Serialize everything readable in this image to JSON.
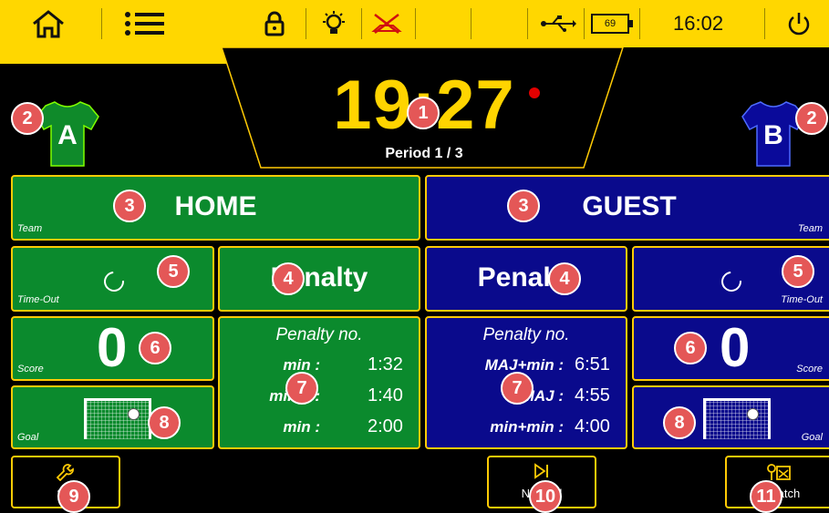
{
  "topbar": {
    "time": "16:02",
    "battery_level": "69",
    "icons": [
      "home-icon",
      "menu-icon",
      "lock-icon",
      "bulb-icon",
      "horn-muted-icon",
      "usb-icon",
      "battery-icon",
      "power-icon"
    ]
  },
  "clock": {
    "value": "19:27",
    "period": "Period 1 / 3"
  },
  "teams": {
    "home": {
      "jersey_letter": "A",
      "name": "HOME",
      "name_label": "Team",
      "timeout_label": "Time-Out",
      "penalty_title": "Penalty",
      "score": "0",
      "score_label": "Score",
      "goal_label": "Goal",
      "penalty_no": "Penalty no.",
      "penalties": [
        {
          "label": "min :",
          "value": "1:32"
        },
        {
          "label": "min T :",
          "value": "1:40"
        },
        {
          "label": "min :",
          "value": "2:00"
        }
      ]
    },
    "guest": {
      "jersey_letter": "B",
      "name": "GUEST",
      "name_label": "Team",
      "timeout_label": "Time-Out",
      "penalty_title": "Penalty",
      "score": "0",
      "score_label": "Score",
      "goal_label": "Goal",
      "penalty_no": "Penalty no.",
      "penalties": [
        {
          "label": "MAJ+min :",
          "value": "6:51"
        },
        {
          "label": "MAJ :",
          "value": "4:55"
        },
        {
          "label": "min+min :",
          "value": "4:00"
        }
      ]
    }
  },
  "buttons": {
    "settings": "Set",
    "next_period": "Next  od",
    "new_match": "N  match"
  },
  "callouts": [
    "1",
    "2",
    "3",
    "4",
    "5",
    "6",
    "7",
    "8",
    "9",
    "10",
    "11"
  ],
  "colors": {
    "accent": "#ffd700",
    "home": "#0b8a2d",
    "guest": "#0a0a8c",
    "clock": "#ffd400",
    "badge": "#e45757"
  }
}
